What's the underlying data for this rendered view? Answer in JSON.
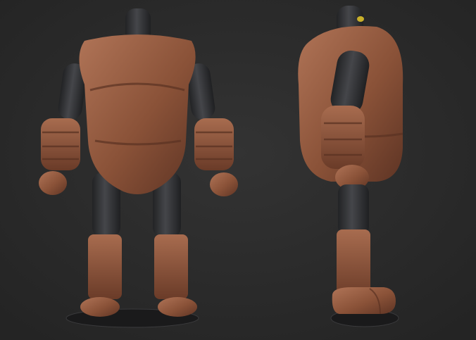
{
  "scene": {
    "background": "#2b2b2b",
    "body_color": "#8a5238",
    "body_highlight": "#b07457",
    "joint_color": "#303133",
    "base_color": "#1c1c1d",
    "accent_color": "#c9b02a"
  },
  "views": [
    {
      "label_name": "robot-front-view"
    },
    {
      "label_name": "robot-side-view"
    }
  ]
}
